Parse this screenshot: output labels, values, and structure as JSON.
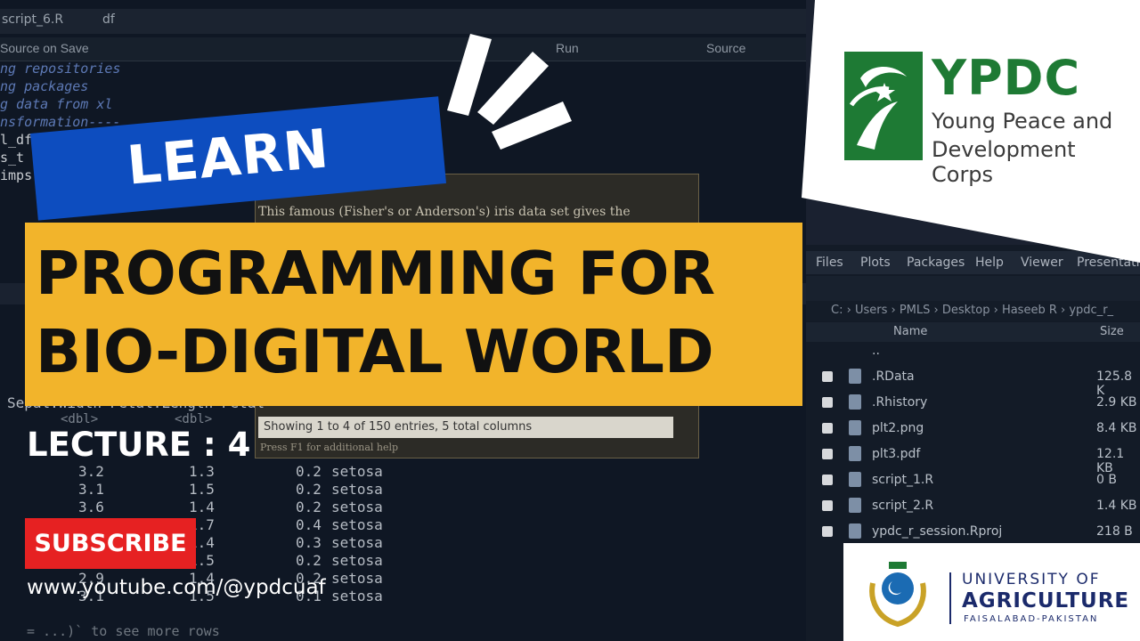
{
  "editor": {
    "tabs": [
      "script_6.R",
      "df"
    ],
    "toolbar": {
      "source_on_save": "Source on Save",
      "run": "Run",
      "source": "Source"
    },
    "code_lines": [
      "ng repositories",
      "ng packages",
      "g data from xl",
      "nsformation----",
      "l_df(",
      "s_t",
      "imps"
    ]
  },
  "dialog": {
    "description": "This famous (Fisher's or Anderson's) iris data set gives the",
    "entries": "Showing 1 to 4 of 150 entries, 5 total columns",
    "help_hint": "Press F1 for additional help"
  },
  "console": {
    "header_fragment": "Sepal.Width Petal.Length Petal",
    "types": [
      "<dbl>",
      "<dbl>"
    ],
    "rows": [
      [
        "3.2",
        "1.3",
        "0.2",
        "setosa"
      ],
      [
        "3.1",
        "1.5",
        "0.2",
        "setosa"
      ],
      [
        "3.6",
        "1.4",
        "0.2",
        "setosa"
      ],
      [
        "",
        "1.7",
        "0.4",
        "setosa"
      ],
      [
        "",
        "1.4",
        "0.3",
        "setosa"
      ],
      [
        "",
        "1.5",
        "0.2",
        "setosa"
      ],
      [
        "2.9",
        "1.4",
        "0.2",
        "setosa"
      ],
      [
        "3.1",
        "1.5",
        "0.1",
        "setosa"
      ]
    ],
    "more_rows": "= ...)` to see more rows"
  },
  "files_pane": {
    "tabs": [
      "Files",
      "Plots",
      "Packages",
      "Help",
      "Viewer",
      "Presentation"
    ],
    "path": [
      "C:",
      "Users",
      "PMLS",
      "Desktop",
      "Haseeb R",
      "ypdc_r_"
    ],
    "columns": {
      "name": "Name",
      "size": "Size"
    },
    "files": [
      {
        "name": "..",
        "size": ""
      },
      {
        "name": ".RData",
        "size": "125.8 K"
      },
      {
        "name": ".Rhistory",
        "size": "2.9 KB"
      },
      {
        "name": "plt2.png",
        "size": "8.4 KB"
      },
      {
        "name": "plt3.pdf",
        "size": "12.1 KB"
      },
      {
        "name": "script_1.R",
        "size": "0 B"
      },
      {
        "name": "script_2.R",
        "size": "1.4 KB"
      },
      {
        "name": "ypdc_r_session.Rproj",
        "size": "218 B"
      }
    ]
  },
  "thumbnail": {
    "learn": "LEARN",
    "title_line1": "PROGRAMMING FOR",
    "title_line2": "BIO-DIGITAL WORLD",
    "lecture": "LECTURE : 4",
    "subscribe": "SUBSCRIBE",
    "youtube": "www.youtube.com/@ypdcuaf"
  },
  "ypdc_logo": {
    "abbr": "YPDC",
    "line1": "Young Peace and",
    "line2": "Development Corps",
    "color": "#1e7a34"
  },
  "uaf_logo": {
    "line1": "UNIVERSITY OF",
    "line2": "AGRICULTURE",
    "line3": "FAISALABAD-PAKISTAN",
    "color": "#1b2a6b"
  },
  "colors": {
    "learn_blue": "#0d4dbf",
    "title_yellow": "#f2b42b",
    "subscribe_red": "#e62122"
  }
}
